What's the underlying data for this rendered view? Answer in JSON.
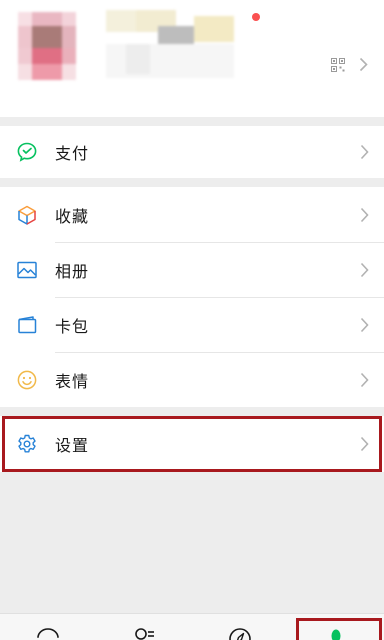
{
  "colors": {
    "accent": "#07c160",
    "highlight": "#a8191e",
    "badge": "#fa5151"
  },
  "profile": {
    "avatar_icon": "blurred-avatar",
    "qr_icon": "qr-code-icon",
    "chevron_icon": "chevron-right-icon"
  },
  "menu": {
    "pay": {
      "label": "支付",
      "icon": "pay-icon"
    },
    "items": [
      {
        "label": "收藏",
        "icon": "favorites-icon"
      },
      {
        "label": "相册",
        "icon": "album-icon"
      },
      {
        "label": "卡包",
        "icon": "cards-icon"
      },
      {
        "label": "表情",
        "icon": "sticker-icon"
      }
    ],
    "settings": {
      "label": "设置",
      "icon": "settings-icon"
    }
  },
  "tabbar": {
    "tabs": [
      {
        "icon": "chats-icon"
      },
      {
        "icon": "contacts-icon"
      },
      {
        "icon": "discover-icon"
      },
      {
        "icon": "me-icon",
        "active": true
      }
    ]
  }
}
